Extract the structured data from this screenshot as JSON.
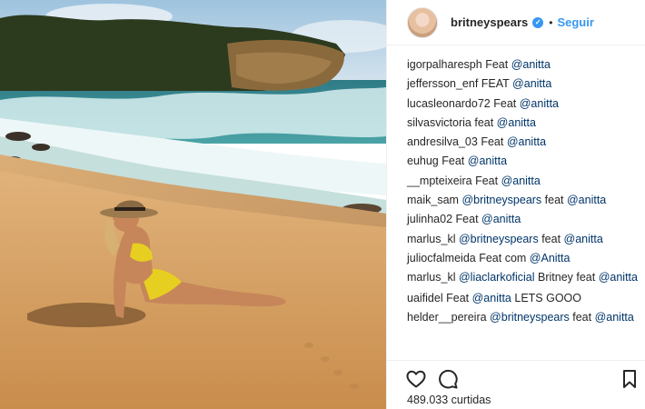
{
  "header": {
    "username": "britneyspears",
    "verified_icon": "verified-badge-icon",
    "separator": "•",
    "follow_label": "Seguir"
  },
  "comments": [
    {
      "user": "igorpalharesph",
      "parts": [
        {
          "t": "Feat ",
          "m": false
        },
        {
          "t": "@anitta",
          "m": true
        }
      ]
    },
    {
      "user": "jeffersson_enf",
      "parts": [
        {
          "t": "FEAT ",
          "m": false
        },
        {
          "t": "@anitta",
          "m": true
        }
      ]
    },
    {
      "user": "lucasleonardo72",
      "parts": [
        {
          "t": "Feat ",
          "m": false
        },
        {
          "t": "@anitta",
          "m": true
        }
      ]
    },
    {
      "user": "silvasvictoria",
      "parts": [
        {
          "t": "feat ",
          "m": false
        },
        {
          "t": "@anitta",
          "m": true
        }
      ]
    },
    {
      "user": "andresilva_03",
      "parts": [
        {
          "t": "Feat ",
          "m": false
        },
        {
          "t": "@anitta",
          "m": true
        }
      ]
    },
    {
      "user": "euhug",
      "parts": [
        {
          "t": "Feat ",
          "m": false
        },
        {
          "t": "@anitta",
          "m": true
        }
      ]
    },
    {
      "user": "__mpteixeira",
      "parts": [
        {
          "t": "Feat ",
          "m": false
        },
        {
          "t": "@anitta",
          "m": true
        }
      ]
    },
    {
      "user": "maik_sam",
      "parts": [
        {
          "t": "@britneyspears",
          "m": true
        },
        {
          "t": " feat ",
          "m": false
        },
        {
          "t": "@anitta",
          "m": true
        }
      ]
    },
    {
      "user": "julinha02",
      "parts": [
        {
          "t": "Feat ",
          "m": false
        },
        {
          "t": "@anitta",
          "m": true
        }
      ]
    },
    {
      "user": "marlus_kl",
      "parts": [
        {
          "t": "@britneyspears",
          "m": true
        },
        {
          "t": " feat ",
          "m": false
        },
        {
          "t": "@anitta",
          "m": true
        }
      ]
    },
    {
      "user": "juliocfalmeida",
      "parts": [
        {
          "t": "Feat com ",
          "m": false
        },
        {
          "t": "@Anitta",
          "m": true
        }
      ]
    },
    {
      "user": "marlus_kl",
      "parts": [
        {
          "t": "@liaclarkoficial",
          "m": true
        },
        {
          "t": " Britney feat ",
          "m": false
        },
        {
          "t": "@anitta",
          "m": true
        }
      ],
      "wrap": true
    },
    {
      "user": "uaifidel",
      "parts": [
        {
          "t": "Feat ",
          "m": false
        },
        {
          "t": "@anitta",
          "m": true
        },
        {
          "t": " LETS GOOO",
          "m": false
        }
      ]
    },
    {
      "user": "helder__pereira",
      "parts": [
        {
          "t": "@britneyspears",
          "m": true
        },
        {
          "t": " feat ",
          "m": false
        },
        {
          "t": "@anitta",
          "m": true
        }
      ],
      "wrap": true
    }
  ],
  "actions": {
    "like_icon": "heart-icon",
    "comment_icon": "comment-bubble-icon",
    "save_icon": "bookmark-icon",
    "likes_text": "489.033 curtidas"
  },
  "colors": {
    "accent": "#3897f0",
    "mention": "#003569",
    "text": "#262626",
    "divider": "#efefef"
  }
}
